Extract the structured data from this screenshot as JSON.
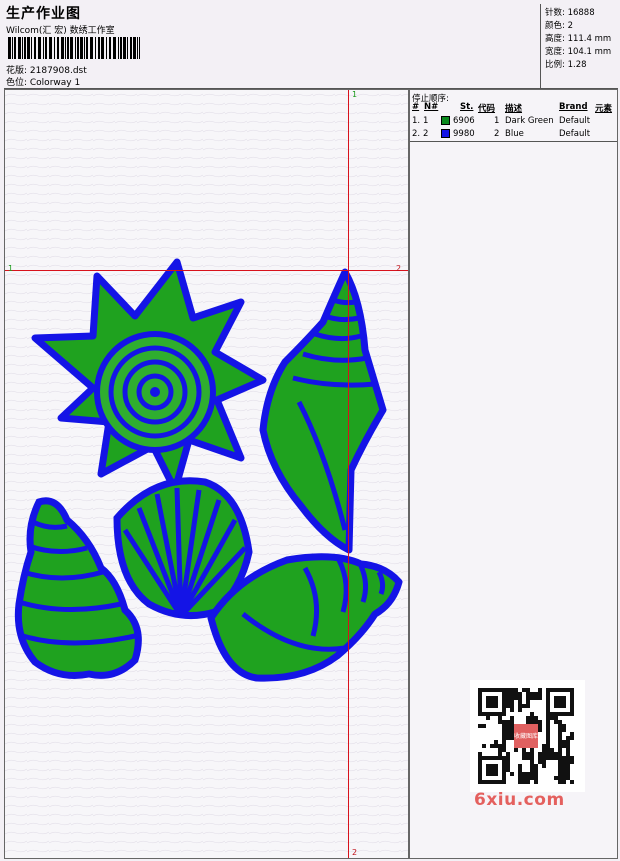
{
  "header": {
    "title": "生产作业图",
    "studio": "Wilcom(汇 宏) 数绣工作室",
    "design": "花版: 2187908.dst",
    "colorway": "色位: Colorway 1"
  },
  "stats": [
    {
      "label": "针数:",
      "value": "16888"
    },
    {
      "label": "颜色:",
      "value": "2"
    },
    {
      "label": "高度:",
      "value": "111.4 mm"
    },
    {
      "label": "宽度:",
      "value": "104.1 mm"
    },
    {
      "label": "比例:",
      "value": "1.28"
    }
  ],
  "stop_sequence": {
    "title": "停止顺序:",
    "columns": [
      "#",
      "N#",
      "St.",
      "代码",
      "描述",
      "Brand",
      "元素"
    ],
    "rows": [
      {
        "index": "1.",
        "n": "1",
        "color": "#0b8a1e",
        "st": "6906",
        "code": "1",
        "desc": "Dark Green",
        "brand": "Default"
      },
      {
        "index": "2.",
        "n": "2",
        "color": "#1414e6",
        "st": "9980",
        "code": "2",
        "desc": "Blue",
        "brand": "Default"
      }
    ]
  },
  "guides": {
    "v_top": "1",
    "v_bottom": "2",
    "h_left": "1",
    "h_right": "2"
  },
  "watermark": "6xiu.com",
  "qr_stamp": "收藏图库"
}
